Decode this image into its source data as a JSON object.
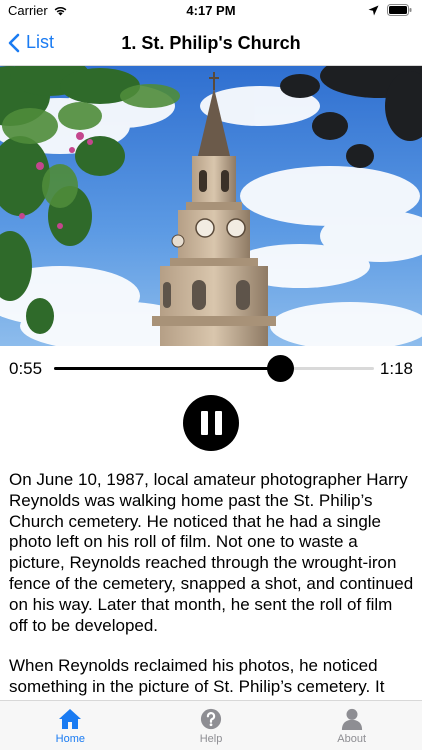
{
  "status_bar": {
    "carrier": "Carrier",
    "time": "4:17 PM"
  },
  "nav": {
    "back_label": "List",
    "title": "1. St. Philip's Church"
  },
  "player": {
    "current_time": "0:55",
    "total_time": "1:18",
    "progress_fraction": 0.705,
    "state": "playing"
  },
  "story": {
    "paragraphs": [
      "On June 10, 1987, local amateur photographer Harry Reynolds was walking home past the St. Philip’s Church cemetery. He noticed that he had a single photo left on his roll of film. Not one to waste a picture, Reynolds reached through the wrought-iron fence of the cemetery, snapped a shot, and continued on his way. Later that month, he sent the roll of film off to be developed.",
      "When Reynolds reclaimed his photos, he noticed something in the picture of St. Philip’s cemetery. It"
    ]
  },
  "tabs": [
    {
      "label": "Home",
      "icon": "home-icon",
      "active": true
    },
    {
      "label": "Help",
      "icon": "help-icon",
      "active": false
    },
    {
      "label": "About",
      "icon": "person-icon",
      "active": false
    }
  ],
  "colors": {
    "accent": "#1a7bf2",
    "inactive": "#8e8e93",
    "player": "#000000"
  }
}
